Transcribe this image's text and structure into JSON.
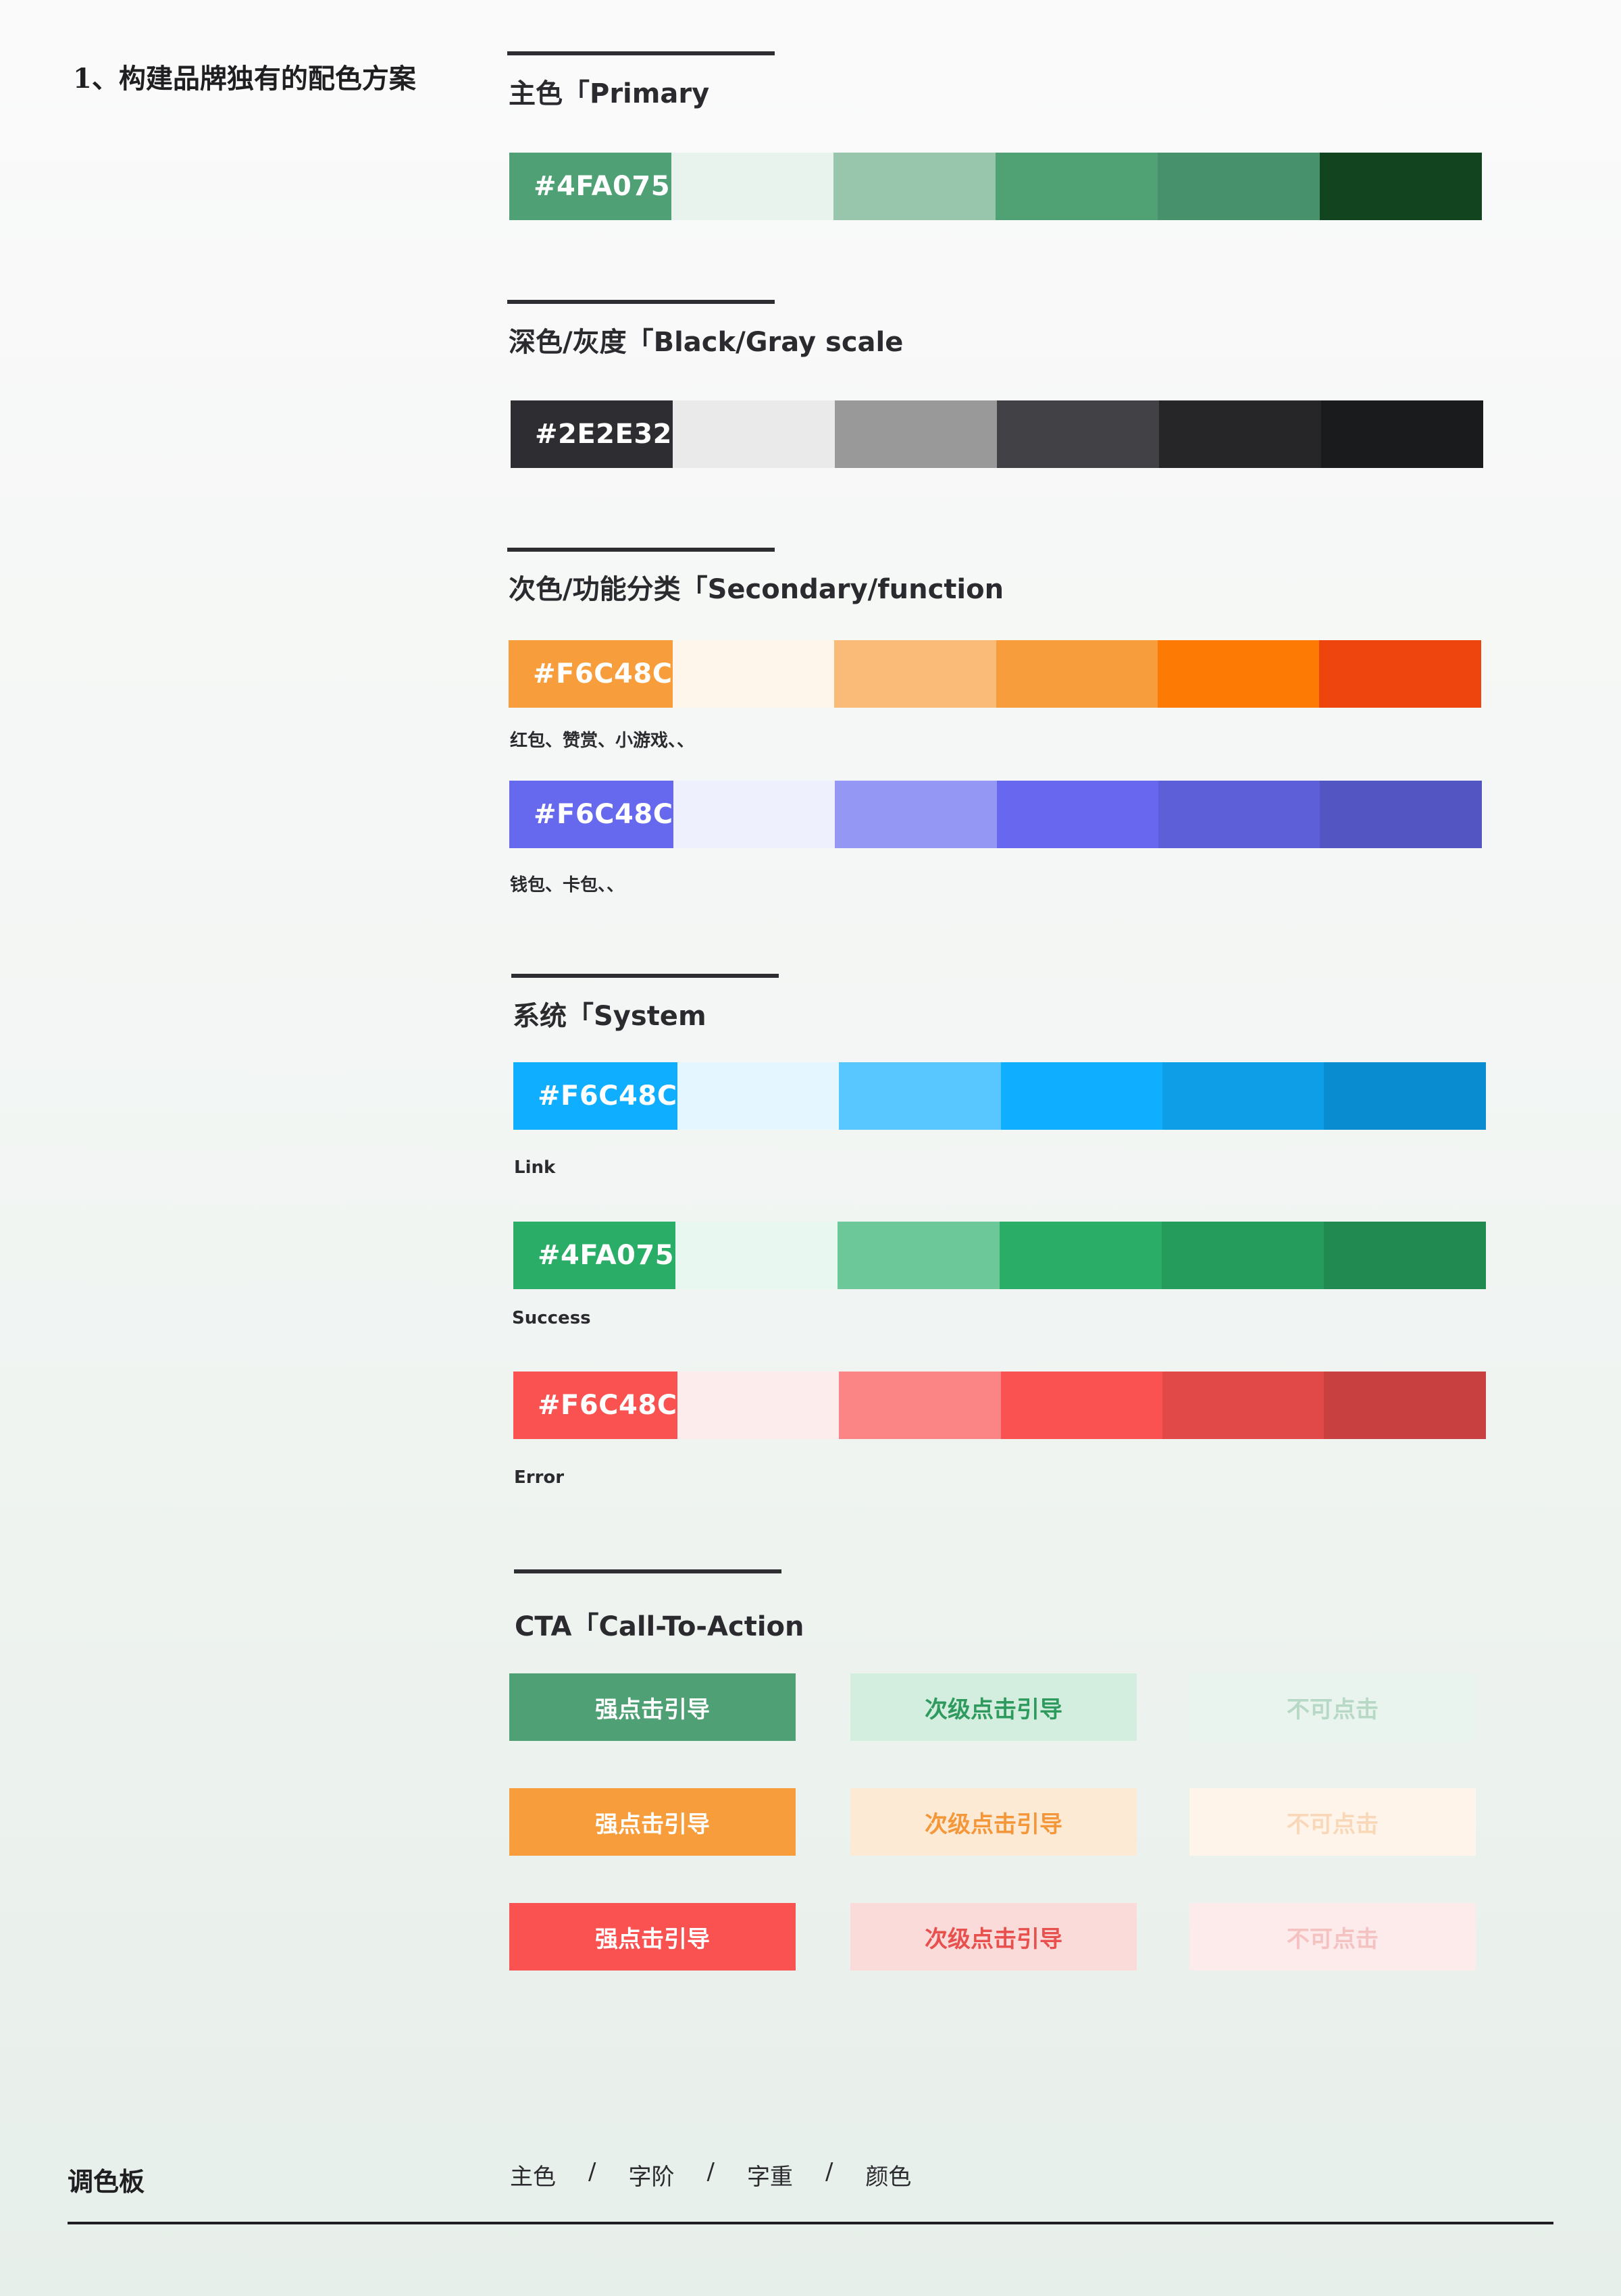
{
  "side_title": "1、构建品牌独有的配色方案",
  "sections": {
    "primary": {
      "title": "主色「Primary",
      "label": "#4FA075",
      "colors": [
        "#4FA075",
        "#E8F3EE",
        "#97C6AC",
        "#50A274",
        "#47916C",
        "#11441F"
      ]
    },
    "gray": {
      "title": "深色/灰度「Black/Gray scale",
      "label": "#2E2E32",
      "colors": [
        "#2E2E32",
        "#EAEAEA",
        "#99999A",
        "#414146",
        "#262629",
        "#1A1B1D"
      ]
    },
    "secondary": {
      "title": "次色/功能分类「Secondary/function",
      "orange": {
        "label": "#F6C48C",
        "note": "红包、赞赏、小游戏、、",
        "colors": [
          "#F79D3B",
          "#FEF5EB",
          "#FABB79",
          "#F89D3B",
          "#FD7A04",
          "#EE440E"
        ]
      },
      "purple": {
        "label": "#F6C48C",
        "note": "钱包、卡包、、",
        "colors": [
          "#6668EE",
          "#EFF0FD",
          "#9597F4",
          "#6768EF",
          "#5D5FD8",
          "#5356C2"
        ]
      }
    },
    "system": {
      "title": "系统「System",
      "link": {
        "label": "#F6C48C",
        "note": "Link",
        "colors": [
          "#10AEFF",
          "#E4F6FF",
          "#58C6FF",
          "#10AEFF",
          "#0E9EE8",
          "#0A8CD0"
        ]
      },
      "success": {
        "label": "#4FA075",
        "note": "Success",
        "colors": [
          "#2AAE67",
          "#E8F7EF",
          "#6CC799",
          "#2AAE67",
          "#259B5C",
          "#208A51"
        ]
      },
      "error": {
        "label": "#F6C48C",
        "note": "Error",
        "colors": [
          "#FA5151",
          "#FDECEC",
          "#FB8585",
          "#FA5151",
          "#E14848",
          "#C94040"
        ]
      }
    },
    "cta": {
      "title": "CTA「Call-To-Action",
      "rows": [
        {
          "primary": {
            "label": "强点击引导",
            "bg": "#4FA075",
            "fg": "#FFFFFF"
          },
          "secondary": {
            "label": "次级点击引导",
            "bg": "#D3EEDF",
            "fg": "#2E9A5E"
          },
          "disabled": {
            "label": "不可点击",
            "bg": "#E9F4EE",
            "fg": "#B7D8C4"
          }
        },
        {
          "primary": {
            "label": "强点击引导",
            "bg": "#F79D3B",
            "fg": "#FFFFFF"
          },
          "secondary": {
            "label": "次级点击引导",
            "bg": "#FDEAD5",
            "fg": "#F4973A"
          },
          "disabled": {
            "label": "不可点击",
            "bg": "#FEF4E9",
            "fg": "#F8D8B8"
          }
        },
        {
          "primary": {
            "label": "强点击引导",
            "bg": "#FA5151",
            "fg": "#FFFFFF"
          },
          "secondary": {
            "label": "次级点击引导",
            "bg": "#FBDADA",
            "fg": "#E8504E"
          },
          "disabled": {
            "label": "不可点击",
            "bg": "#FDEBEB",
            "fg": "#F5C2C2"
          }
        }
      ]
    }
  },
  "footer": {
    "title": "调色板",
    "nav": [
      "主色",
      "字阶",
      "字重",
      "颜色"
    ],
    "separator": "/"
  }
}
